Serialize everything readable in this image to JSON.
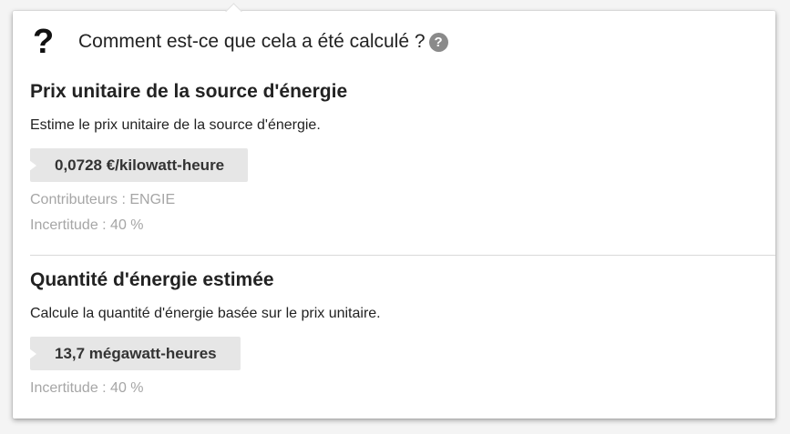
{
  "header": {
    "question_mark": "?",
    "title": "Comment est-ce que cela a été calculé ?",
    "help_glyph": "?"
  },
  "sections": [
    {
      "title": "Prix unitaire de la source d'énergie",
      "description": "Estime le prix unitaire de la source d'énergie.",
      "value": "0,0728 €/kilowatt-heure",
      "contributors": "Contributeurs : ENGIE",
      "uncertainty": "Incertitude : 40 %"
    },
    {
      "title": "Quantité d'énergie estimée",
      "description": "Calcule la quantité d'énergie basée sur le prix unitaire.",
      "value": "13,7 mégawatt-heures",
      "uncertainty": "Incertitude : 40 %"
    }
  ],
  "icons": {
    "header": "question-mark-icon",
    "help": "help-circle-icon"
  },
  "colors": {
    "tag_background": "#e6e6e6",
    "meta_text": "#a6a6a6",
    "help_icon": "#8a8a8a"
  }
}
